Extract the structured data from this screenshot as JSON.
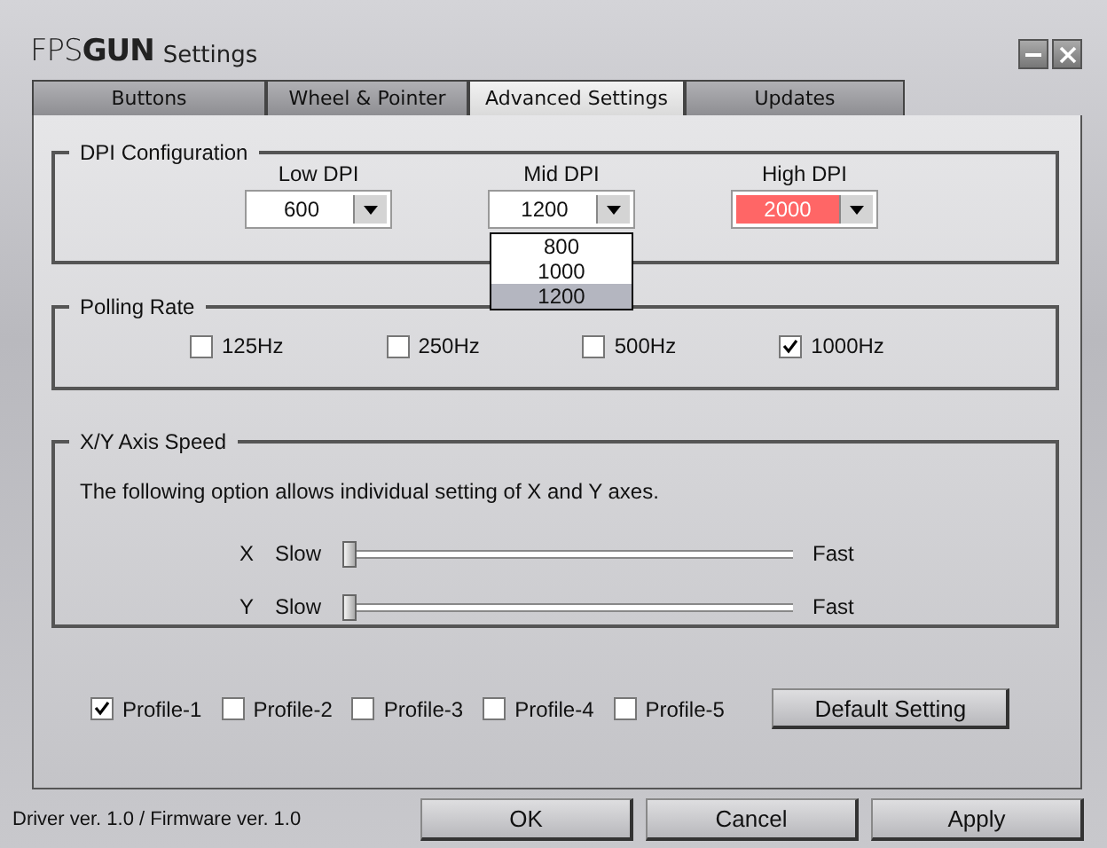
{
  "window": {
    "logo": "FPS**GUN**",
    "title": "Settings"
  },
  "tabs": [
    {
      "label": "Buttons",
      "selected": false
    },
    {
      "label": "Wheel & Pointer",
      "selected": false
    },
    {
      "label": "Advanced Settings",
      "selected": true
    },
    {
      "label": "Updates",
      "selected": false
    }
  ],
  "dpi": {
    "title": "DPI Configuration",
    "dropdowns": [
      {
        "label": "Low DPI",
        "value": "600",
        "color": "#ffffff"
      },
      {
        "label": "Mid DPI",
        "value": "1200",
        "color": "#ffffff",
        "options": [
          {
            "label": "800",
            "selected": false
          },
          {
            "label": "1000",
            "selected": false
          },
          {
            "label": "1200",
            "selected": true
          }
        ]
      },
      {
        "label": "High DPI",
        "value": "2000",
        "color": "#ff6666"
      }
    ]
  },
  "polling": {
    "title": "Polling Rate",
    "options": [
      {
        "label": "125Hz",
        "checked": false
      },
      {
        "label": "250Hz",
        "checked": false
      },
      {
        "label": "500Hz",
        "checked": false
      },
      {
        "label": "1000Hz",
        "checked": true
      }
    ]
  },
  "axis": {
    "title": "X/Y Axis Speed",
    "description": "The following option allows individual setting of X and Y axes.",
    "sliders": [
      {
        "axis": "X",
        "min_label": "Slow",
        "max_label": "Fast",
        "level": 0
      },
      {
        "axis": "Y",
        "min_label": "Slow",
        "max_label": "Fast",
        "level": 0
      }
    ]
  },
  "profiles": [
    {
      "label": "Profile-1",
      "checked": true
    },
    {
      "label": "Profile-2",
      "checked": false
    },
    {
      "label": "Profile-3",
      "checked": false
    },
    {
      "label": "Profile-4",
      "checked": false
    },
    {
      "label": "Profile-5",
      "checked": false
    }
  ],
  "default_button": "Default Setting",
  "status": "Driver ver. 1.0 / Firmware ver. 1.0",
  "buttons": [
    "OK",
    "Cancel",
    "Apply"
  ]
}
